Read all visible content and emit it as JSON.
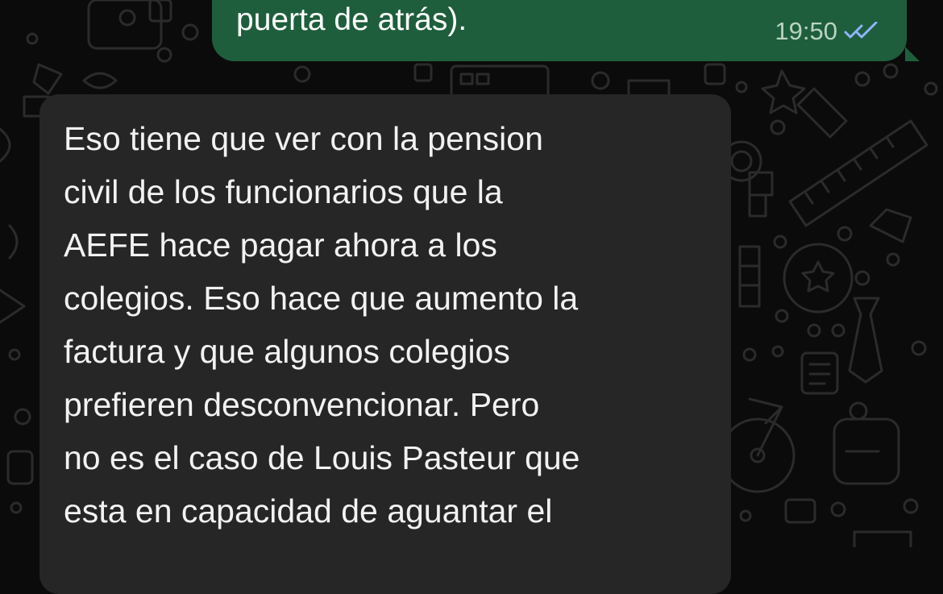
{
  "chat": {
    "outgoing": {
      "text": "puerta de atrás).",
      "time": "19:50",
      "status_icon": "double-check-read-icon"
    },
    "incoming": {
      "lines": [
        "Eso tiene que ver con la pension",
        "civil de los funcionarios que la",
        "AEFE hace pagar ahora a los",
        "colegios. Eso hace que aumento la",
        "factura y que algunos colegios",
        "prefieren desconvencionar. Pero",
        "no es el caso de Louis Pasteur que",
        "esta en capacidad de aguantar el"
      ]
    }
  },
  "theme": {
    "background": "#0b0b0b",
    "outgoing_bubble": "#1e5e3c",
    "incoming_bubble": "#262626",
    "read_ticks": "#8fb4ff"
  }
}
